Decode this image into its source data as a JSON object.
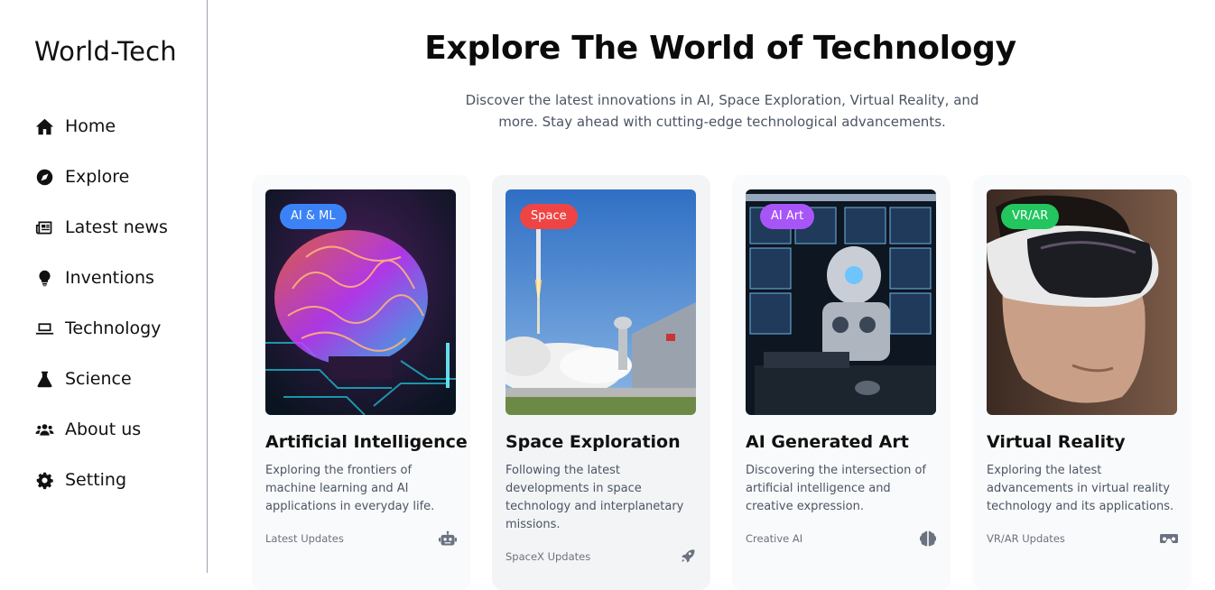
{
  "brand": "World-Tech",
  "nav": [
    {
      "label": "Home",
      "icon": "home-icon"
    },
    {
      "label": "Explore",
      "icon": "compass-icon"
    },
    {
      "label": "Latest news",
      "icon": "newspaper-icon"
    },
    {
      "label": "Inventions",
      "icon": "lightbulb-icon"
    },
    {
      "label": "Technology",
      "icon": "laptop-icon"
    },
    {
      "label": "Science",
      "icon": "flask-icon"
    },
    {
      "label": "About us",
      "icon": "users-icon"
    },
    {
      "label": "Setting",
      "icon": "gear-icon"
    }
  ],
  "hero": {
    "title": "Explore The World of Technology",
    "subtitle": "Discover the latest innovations in AI, Space Exploration, Virtual Reality, and more. Stay ahead with cutting-edge technological advancements."
  },
  "cards": [
    {
      "badge": "AI & ML",
      "badge_color": "#3b82f6",
      "title": "Artificial Intelligence",
      "desc": "Exploring the frontiers of machine learning and AI applications in everyday life.",
      "footer": "Latest Updates",
      "icon": "robot-icon"
    },
    {
      "badge": "Space",
      "badge_color": "#ef4444",
      "title": "Space Exploration",
      "desc": "Following the latest developments in space technology and interplanetary missions.",
      "footer": "SpaceX Updates",
      "icon": "rocket-icon"
    },
    {
      "badge": "AI Art",
      "badge_color": "#a855f7",
      "title": "AI Generated Art",
      "desc": "Discovering the intersection of artificial intelligence and creative expression.",
      "footer": "Creative AI",
      "icon": "brain-icon"
    },
    {
      "badge": "VR/AR",
      "badge_color": "#22c55e",
      "title": "Virtual Reality",
      "desc": "Exploring the latest advancements in virtual reality technology and its applications.",
      "footer": "VR/AR Updates",
      "icon": "vr-headset-icon"
    }
  ]
}
